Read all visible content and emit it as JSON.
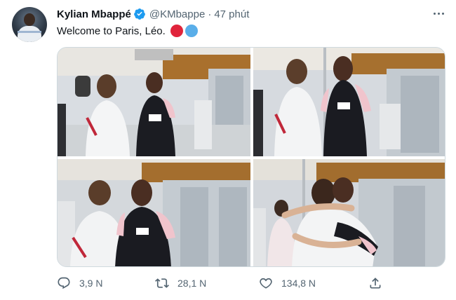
{
  "author": {
    "display_name": "Kylian Mbappé",
    "handle": "@KMbappe",
    "separator": "·",
    "time": "47 phút",
    "verified": true,
    "verified_color": "#1d9bf0"
  },
  "tweet": {
    "text": "Welcome to Paris, Léo.",
    "emoji_colors": [
      "#e0243b",
      "#5aaee9"
    ]
  },
  "media": {
    "photo_count": 4
  },
  "actions": {
    "reply_count": "3,9 N",
    "retweet_count": "28,1 N",
    "like_count": "134,8 N",
    "icons": [
      "reply-icon",
      "retweet-icon",
      "like-icon",
      "share-icon"
    ]
  },
  "colors": {
    "text_primary": "#0f1419",
    "text_secondary": "#536471",
    "border": "#cfd9de"
  }
}
